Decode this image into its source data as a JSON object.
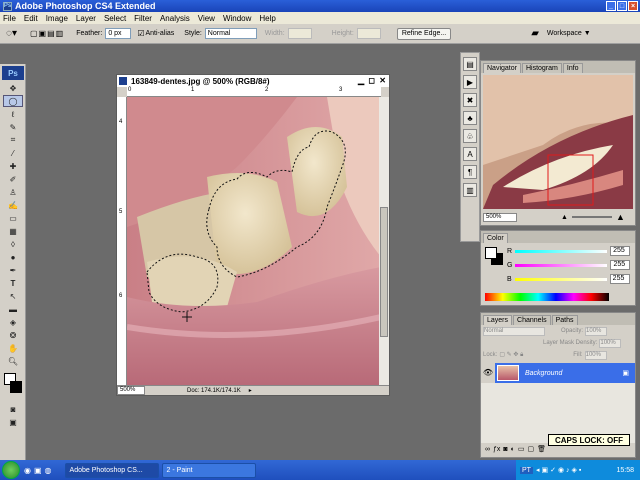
{
  "window": {
    "title": "Adobe Photoshop CS4 Extended",
    "icon": "Ps"
  },
  "menu": [
    "File",
    "Edit",
    "Image",
    "Layer",
    "Select",
    "Filter",
    "Analysis",
    "View",
    "Window",
    "Help"
  ],
  "options": {
    "feather_label": "Feather:",
    "feather_value": "0 px",
    "antialias_label": "Anti-alias",
    "style_label": "Style:",
    "style_value": "Normal",
    "width_label": "Width:",
    "height_label": "Height:",
    "refine_label": "Refine Edge...",
    "workspace_label": "Workspace ▼"
  },
  "toolbox": {
    "logo": "Ps"
  },
  "document": {
    "title": "163849-dentes.jpg @ 500% (RGB/8#)",
    "zoom": "500%",
    "doc_info": "Doc: 174.1K/174.1K",
    "ruler_h": [
      "0",
      "1",
      "2",
      "3"
    ],
    "ruler_v": [
      "4",
      "5",
      "6"
    ]
  },
  "navigator": {
    "tabs": [
      "Navigator",
      "Histogram",
      "Info"
    ],
    "zoom": "500%"
  },
  "color": {
    "tab": "Color",
    "r_label": "R",
    "r_value": "255",
    "g_label": "G",
    "g_value": "255",
    "b_label": "B",
    "b_value": "255"
  },
  "layers": {
    "tabs": [
      "Layers",
      "Channels",
      "Paths"
    ],
    "blend_mode": "Normal",
    "opacity_label": "Opacity:",
    "opacity_value": "100%",
    "mask_density_label": "Layer Mask Density:",
    "mask_density_value": "100%",
    "lock_label": "Lock:",
    "fill_label": "Fill:",
    "fill_value": "100%",
    "layer_name": "Background"
  },
  "caps_lock": "CAPS LOCK: OFF",
  "taskbar": {
    "tasks": [
      "Adobe Photoshop CS...",
      "2 - Paint"
    ],
    "lang": "PT",
    "clock": "15:58"
  }
}
